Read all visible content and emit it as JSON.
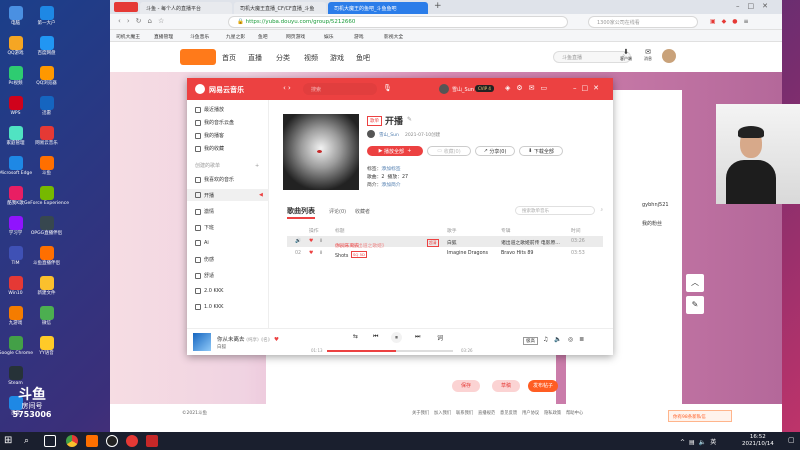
{
  "desktop": {
    "icons_col1": [
      {
        "label": "电脑",
        "color": "#4a90e2"
      },
      {
        "label": "QQ游戏",
        "color": "#f5a623"
      },
      {
        "label": "Ps视频",
        "color": "#2ecc71"
      },
      {
        "label": "WPS",
        "color": "#d0021b"
      },
      {
        "label": "家庭管理",
        "color": "#50e3c2"
      },
      {
        "label": "Microsoft Edge",
        "color": "#1e88e5"
      },
      {
        "label": "酷我K歌",
        "color": "#e91e63"
      },
      {
        "label": "学习学",
        "color": "#9013fe"
      },
      {
        "label": "TIM",
        "color": "#3f51b5"
      },
      {
        "label": "Win10",
        "color": "#e53935"
      },
      {
        "label": "九游戏",
        "color": "#f57c00"
      },
      {
        "label": "Google Chrome",
        "color": "#43a047"
      },
      {
        "label": "Steam",
        "color": "#263238"
      },
      {
        "label": "百度",
        "color": "#1e88e5"
      }
    ],
    "icons_col2": [
      {
        "label": "第一大户",
        "color": "#1e88e5"
      },
      {
        "label": "百度网盘",
        "color": "#2196f3"
      },
      {
        "label": "QQ浏览器",
        "color": "#ff9800"
      },
      {
        "label": "迅雷",
        "color": "#1565c0"
      },
      {
        "label": "网易云音乐",
        "color": "#e53935"
      },
      {
        "label": "斗鱼",
        "color": "#ff6f00"
      },
      {
        "label": "GeForce Experience",
        "color": "#76b900"
      },
      {
        "label": "OPGG直播伴侣",
        "color": "#37474f"
      },
      {
        "label": "斗鱼直播伴侣",
        "color": "#ff6f00"
      },
      {
        "label": "新建文件",
        "color": "#fbc02d"
      },
      {
        "label": "微信",
        "color": "#4caf50"
      },
      {
        "label": "YY语音",
        "color": "#ffca28"
      }
    ],
    "watermark": {
      "line1": "斗鱼",
      "line2": "房间号",
      "room": "5753006"
    }
  },
  "browser": {
    "tabs": [
      {
        "label": "斗鱼 - 每个人的直播平台",
        "active": false
      },
      {
        "label": "司机大魔王直播_CF/CF直播_斗鱼",
        "active": false
      },
      {
        "label": "司机大魔王的鱼吧_斗鱼鱼吧",
        "active": true
      }
    ],
    "new_tab": "+",
    "url": "https://yuba.douyu.com/group/5212660",
    "search_placeholder": "1300家公司在线看",
    "bookmarks": [
      "司机大魔王",
      "直播管理",
      "斗鱼音乐",
      "九星之影",
      "鱼吧",
      "网页游戏",
      "娱乐",
      "游戏",
      "影视大全"
    ],
    "page": {
      "nav": [
        "首页",
        "直播",
        "分类",
        "视频",
        "游戏",
        "鱼吧"
      ],
      "search_placeholder": "斗鱼直播",
      "header_right": [
        "客户端",
        "消息"
      ],
      "footer": "©2021斗鱼",
      "footer_links": [
        "关于我们",
        "加入我们",
        "联系我们",
        "直播规范",
        "意见反馈",
        "用户协议",
        "隐私政策",
        "帮助中心"
      ],
      "side_text": [
        "嗨",
        "游戏",
        "gybhnj521",
        "我的粉丝",
        "鱼丸",
        "小鱼"
      ],
      "action_buttons": [
        "保存",
        "草稿",
        "发布帖子"
      ],
      "toast": "你有98条新私信"
    }
  },
  "music": {
    "app_name": "网易云音乐",
    "search_placeholder": "搜索",
    "user": "雪山_Sun",
    "vip": "CVIP 4",
    "sidebar_top": [
      "最近播放",
      "我的音乐云盘",
      "我的播客",
      "我的收藏"
    ],
    "sidebar_section": "创建的歌单",
    "sidebar_playlists": [
      "我喜欢的音乐",
      "开播",
      "激情",
      "下班",
      "Ai",
      "伤感",
      "舒适",
      "2.0 KKK",
      "1.0 KKK"
    ],
    "playlist": {
      "tag": "歌单",
      "title": "开播",
      "creator": "雪山_Sun",
      "created": "2021-07-10创建",
      "play_all": "播放全部",
      "collect": "收藏(0)",
      "share": "分享(0)",
      "download": "下载全部",
      "tags_label": "标签：",
      "tags_value": "添加标签",
      "songs_label": "歌曲：",
      "songs_value": "2",
      "plays_label": "播放：",
      "plays_value": "27",
      "intro_label": "简介：",
      "intro_value": "添加简介"
    },
    "tabs": [
      "歌曲列表",
      "评论(0)",
      "收藏者"
    ],
    "search_list_placeholder": "搜索歌单音乐",
    "columns": [
      "操作",
      "标题",
      "歌手",
      "专辑",
      "时间"
    ],
    "songs": [
      {
        "index": "01",
        "title": "你从未离去",
        "extra": "(纯享)《新出道之歌姬》",
        "badge": "超清",
        "artist": "白狐",
        "album": "诸出道之歌姬前传 电影原...",
        "time": "03:26"
      },
      {
        "index": "02",
        "title": "Shots",
        "extra": "",
        "badge": "SQ 5D",
        "artist": "Imagine Dragons",
        "album": "Bravo Hits 89",
        "time": "03:53"
      }
    ],
    "player": {
      "now_title": "你从未离去",
      "now_extra": "(纯享)《名》",
      "now_artist": "白狐",
      "elapsed": "01:13",
      "total": "03:26",
      "progress": 0.55,
      "quality": "极高"
    }
  },
  "taskbar": {
    "time": "16:52",
    "date": "2021/10/14"
  }
}
